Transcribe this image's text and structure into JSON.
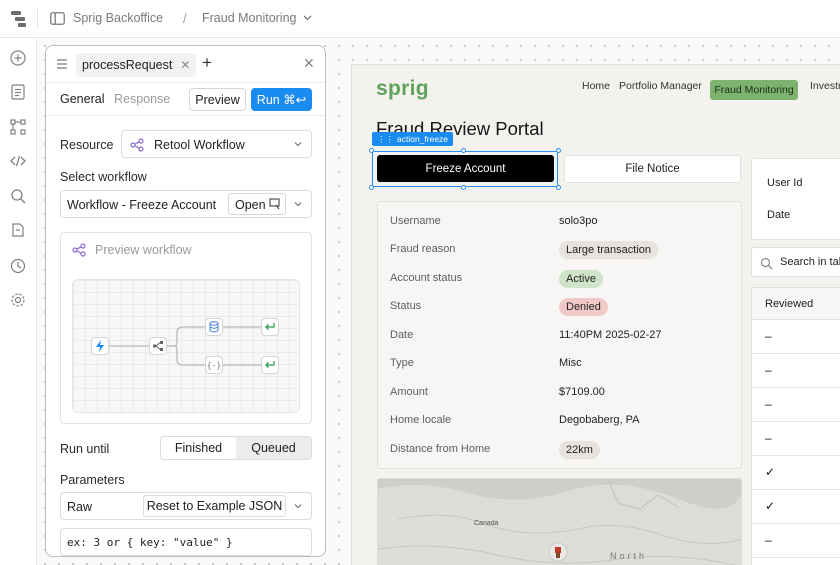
{
  "topbar": {
    "app_name": "Sprig Backoffice",
    "separator": "/",
    "page_name": "Fraud Monitoring"
  },
  "query": {
    "tab_name": "processRequest",
    "subtabs": {
      "general": "General",
      "response": "Response"
    },
    "preview_label": "Preview",
    "run_label": "Run ⌘↩",
    "resource_label": "Resource",
    "resource_value": "Retool Workflow",
    "select_workflow_label": "Select workflow",
    "workflow_value": "Workflow - Freeze Account",
    "open_label": "Open",
    "preview_workflow_label": "Preview workflow",
    "run_until_label": "Run until",
    "run_until_options": [
      "Finished",
      "Queued"
    ],
    "run_until_selected": "Finished",
    "parameters_label": "Parameters",
    "param_mode": "Raw",
    "reset_label": "Reset to Example JSON",
    "param_placeholder": "ex: 3 or { key: \"value\" }"
  },
  "app": {
    "brand": "sprig",
    "nav": [
      "Home",
      "Portfolio Manager",
      "Fraud Monitoring",
      "Investr"
    ],
    "nav_active": "Fraud Monitoring",
    "title": "Fraud Review Portal",
    "selected_component": "action_freeze",
    "freeze_label": "Freeze Account",
    "notice_label": "File Notice",
    "details": [
      {
        "label": "Username",
        "value": "solo3po"
      },
      {
        "label": "Fraud reason",
        "value": "Large transaction"
      },
      {
        "label": "Account status",
        "value": "Active"
      },
      {
        "label": "Status",
        "value": "Denied"
      },
      {
        "label": "Date",
        "value": "11:40PM 2025-02-27"
      },
      {
        "label": "Type",
        "value": "Misc"
      },
      {
        "label": "Amount",
        "value": "$7109.00"
      },
      {
        "label": "Home locale",
        "value": "Degobaberg, PA"
      },
      {
        "label": "Distance from Home",
        "value": "22km"
      }
    ],
    "map_labels": {
      "canada": "Canada",
      "north": "North"
    },
    "filters": {
      "user_id": "User Id",
      "date": "Date"
    },
    "search_placeholder": "Search in table",
    "table_header": "Reviewed",
    "table_rows": [
      "–",
      "–",
      "–",
      "–",
      "✓",
      "✓",
      "–"
    ],
    "colors": {
      "accent": "#1a8bf0",
      "brand": "#5fa35a",
      "nav_active_bg": "#7db26f",
      "pill_neutral": "#e6e3df",
      "pill_active": "#cfe3c8",
      "pill_denied": "#f2c9c9"
    }
  }
}
